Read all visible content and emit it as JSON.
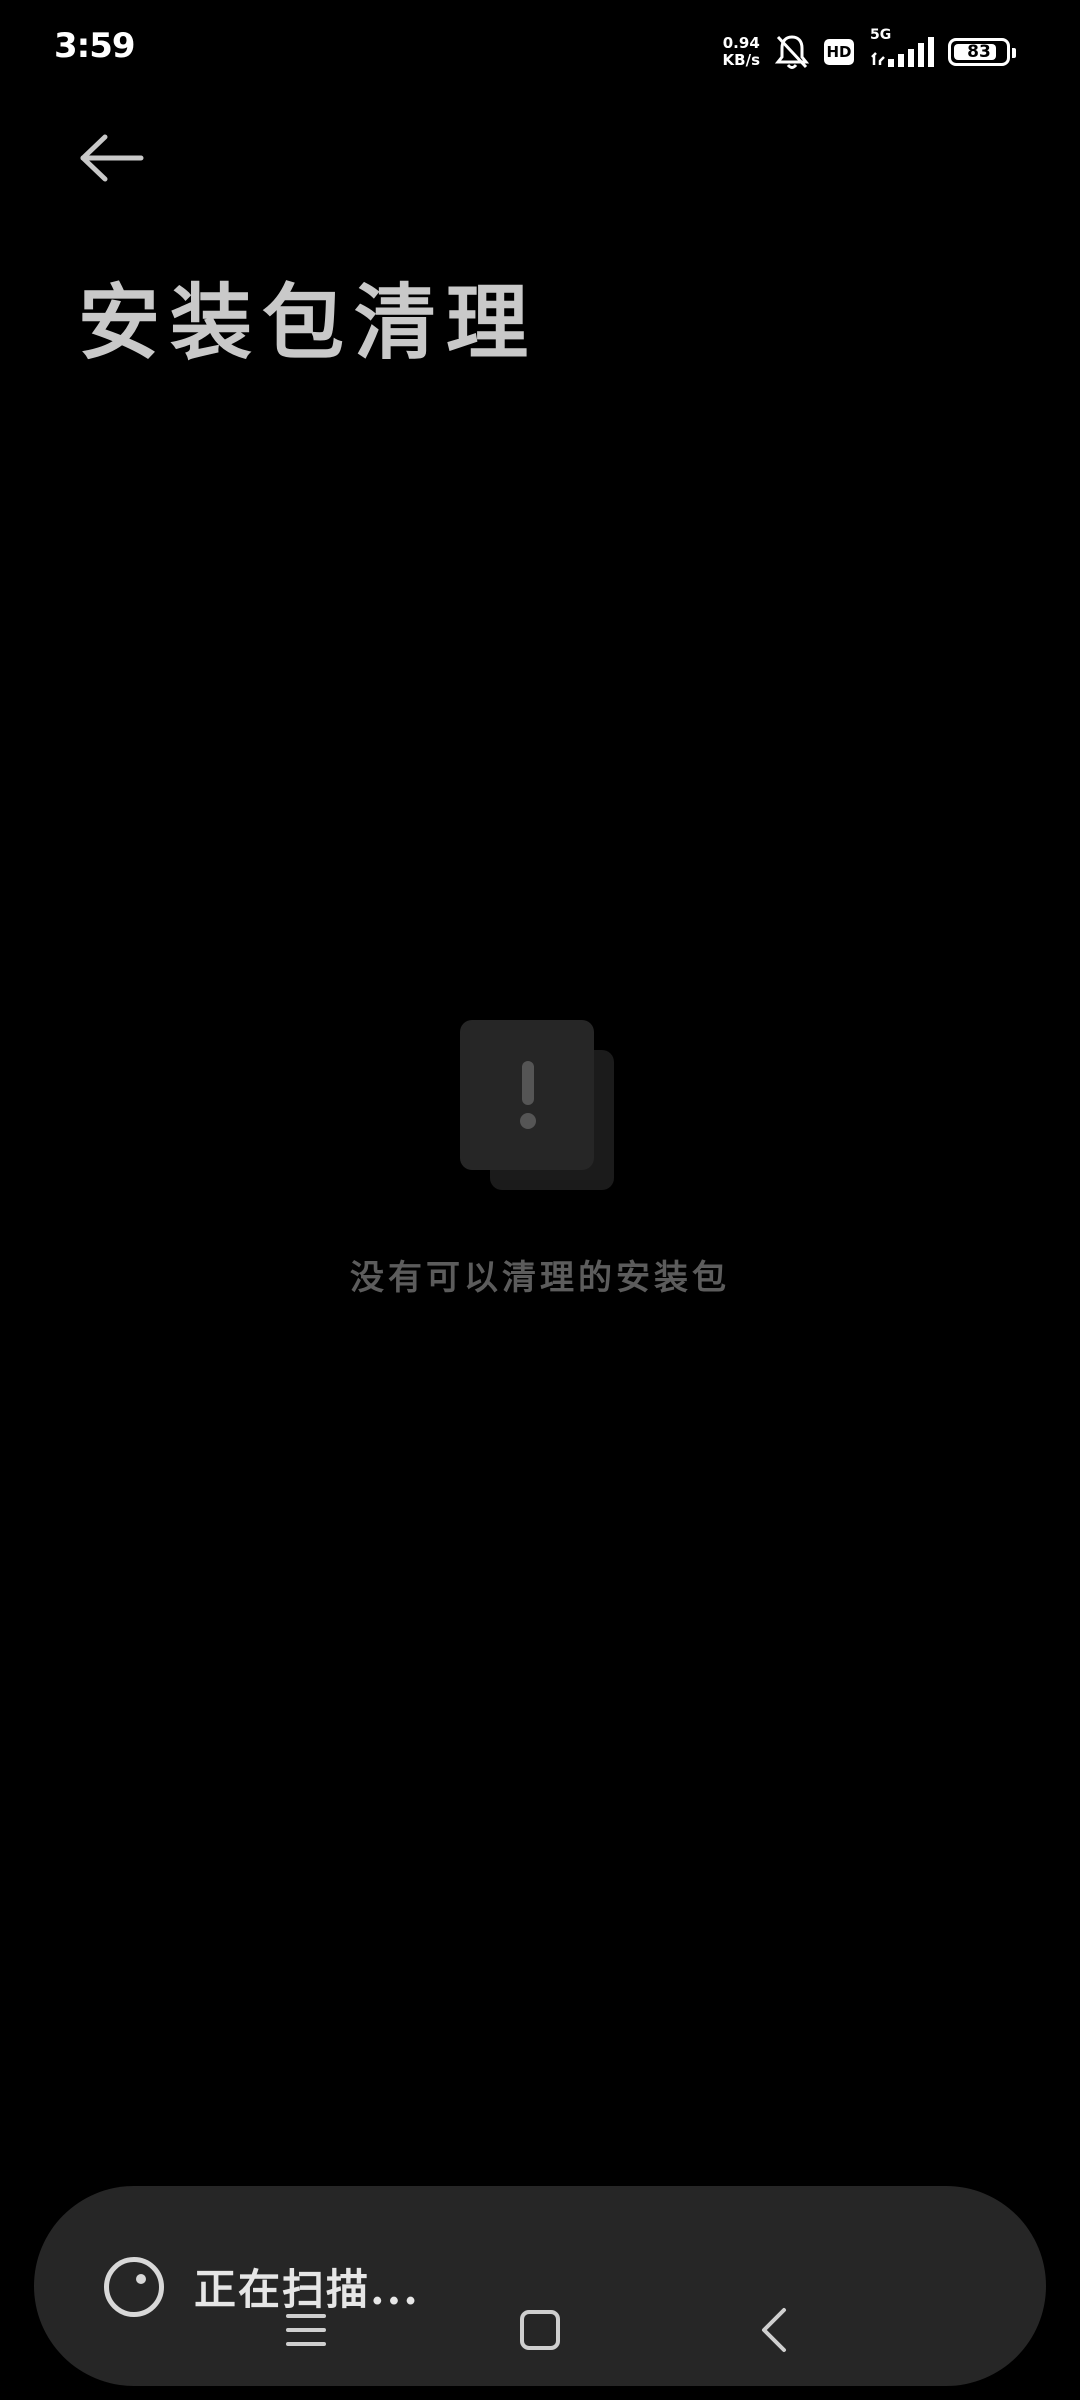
{
  "status_bar": {
    "time": "3:59",
    "net_speed_value": "0.94",
    "net_speed_unit": "KB/s",
    "hd_label": "HD",
    "network_type": "5G",
    "battery_level": "83",
    "battery_percent": 83
  },
  "header": {
    "back_icon": "back-arrow-icon",
    "title": "安装包清理"
  },
  "empty_state": {
    "icon": "empty-document-icon",
    "message": "没有可以清理的安装包"
  },
  "scan_panel": {
    "icon": "scanning-spinner-icon",
    "status_text": "正在扫描..."
  },
  "nav_bar": {
    "items": [
      "menu-icon",
      "home-icon",
      "back-icon"
    ]
  },
  "colors": {
    "background": "#000000",
    "title": "#c9c9c9",
    "empty_message": "#5c5c5c",
    "panel": "#262626"
  }
}
